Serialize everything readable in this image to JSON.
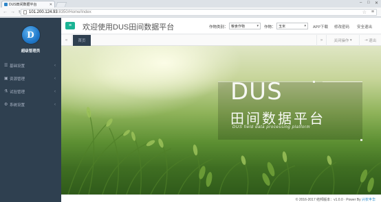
{
  "browser": {
    "tab_title": "DUS田间数据平台",
    "url_host": "101.200.124.93",
    "url_path": ":8350/Home/Index",
    "controls": {
      "minimize": "–",
      "maximize": "□",
      "close": "✕"
    }
  },
  "sidebar": {
    "role": "超级管理员",
    "items": [
      {
        "label": "基础设置",
        "icon": "list-icon"
      },
      {
        "label": "资源管理",
        "icon": "folder-icon"
      },
      {
        "label": "试验管理",
        "icon": "flask-icon"
      },
      {
        "label": "系统设置",
        "icon": "gears-icon"
      }
    ]
  },
  "header": {
    "title": "欢迎使用DUS田间数据平台",
    "crop_category_label": "作物类别：",
    "crop_category_value": "粮食作物",
    "crop_label": "作物：",
    "crop_value": "玉米",
    "app_download": "APP下载",
    "change_password": "修改密码",
    "safe_logout": "安全退出"
  },
  "tabs": {
    "home": "首页",
    "close_ops": "关闭操作",
    "logout": "退出"
  },
  "hero": {
    "big": "DUS",
    "cn": "田间数据平台",
    "en": "DUS field data processing platform"
  },
  "footer": {
    "text": "© 2016-2017 结邦版本：v1.0.0 · Power By ",
    "link": "兴农丰华"
  },
  "colors": {
    "sidebar_bg": "#2f4050",
    "accent_green": "#1ab394",
    "link_blue": "#1c84c6"
  }
}
